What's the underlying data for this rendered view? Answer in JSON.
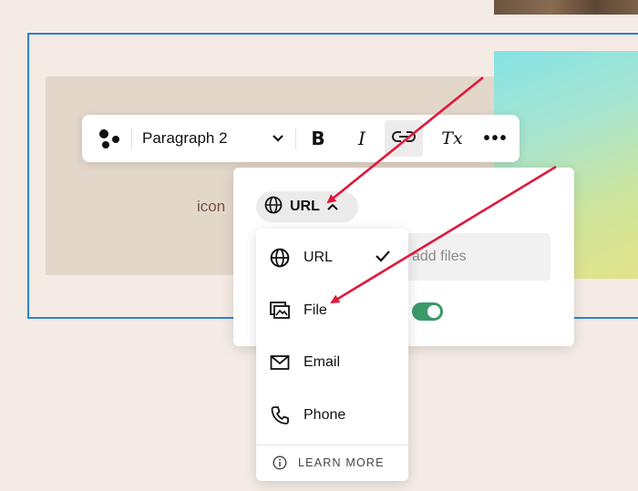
{
  "canvas": {
    "text_block_content": "icon"
  },
  "toolbar": {
    "style_select": "Paragraph 2",
    "bold_label": "B",
    "italic_label": "I",
    "clear_format_label": "Tx",
    "more_label": "•••",
    "active_tool": "link"
  },
  "link_panel": {
    "type_chip_label": "URL",
    "input_placeholder": "add files",
    "toggle_on": true
  },
  "link_type_menu": {
    "items": [
      {
        "label": "URL",
        "icon": "globe-icon",
        "selected": true
      },
      {
        "label": "File",
        "icon": "image-file-icon",
        "selected": false
      },
      {
        "label": "Email",
        "icon": "envelope-icon",
        "selected": false
      },
      {
        "label": "Phone",
        "icon": "phone-icon",
        "selected": false
      }
    ],
    "learn_more_label": "LEARN MORE"
  },
  "colors": {
    "selection_border": "#2f7fe0",
    "annotation_arrow": "#e0183c",
    "toggle_on": "#3a9a6a",
    "page_bg": "#f3ebe4"
  }
}
